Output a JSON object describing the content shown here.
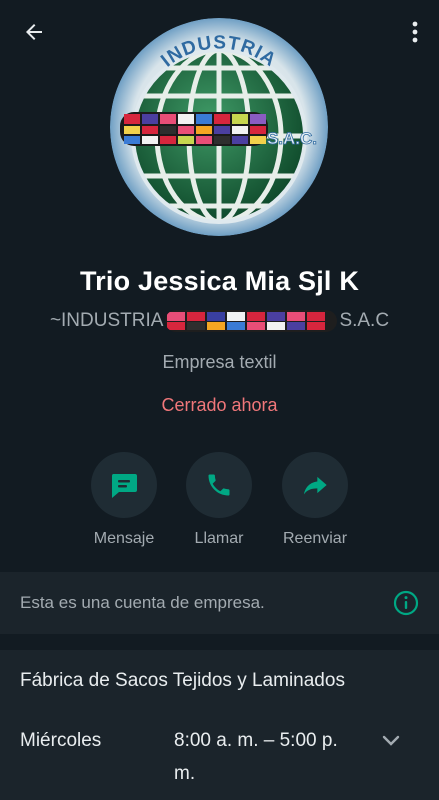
{
  "colors": {
    "background": "#121b22",
    "card": "#1b242b",
    "action_circle": "#1f2c34",
    "accent_green": "#00a884",
    "status_red": "#f0777a",
    "secondary_text": "#a3abb1"
  },
  "header": {
    "back_icon": "arrow-left-icon",
    "menu_icon": "more-vertical-icon"
  },
  "profile": {
    "avatar_ring_text": "INDUSTRIA",
    "avatar_side_text": "S.A.C.",
    "name": "Trio Jessica Mia Sjl K",
    "subname_prefix": "~INDUSTRIA",
    "subname_suffix": "S.A.C",
    "category": "Empresa textil",
    "status": "Cerrado ahora"
  },
  "actions": [
    {
      "label": "Mensaje",
      "icon": "message-icon"
    },
    {
      "label": "Llamar",
      "icon": "phone-icon"
    },
    {
      "label": "Reenviar",
      "icon": "forward-icon"
    }
  ],
  "business_notice": {
    "text": "Esta es una cuenta de empresa.",
    "icon": "info-icon"
  },
  "business_info": {
    "description": "Fábrica de Sacos Tejidos y Laminados",
    "day": "Miércoles",
    "hours": "8:00 a. m. – 5:00 p. m.",
    "expand_icon": "chevron-down-icon"
  }
}
